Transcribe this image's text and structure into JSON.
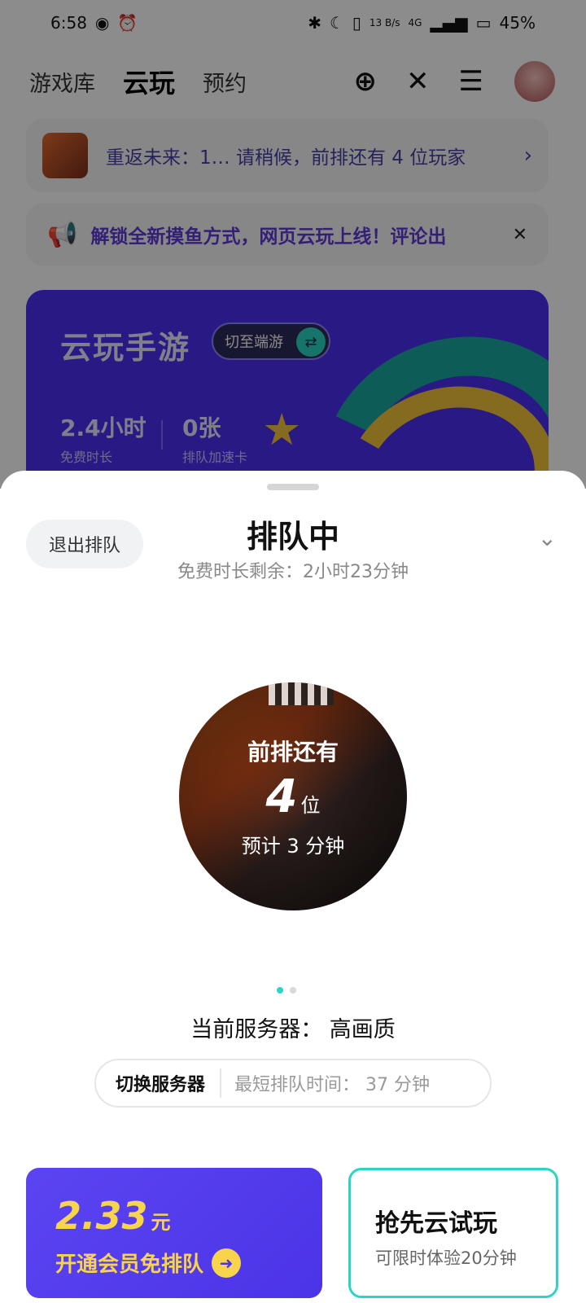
{
  "status_bar": {
    "time": "6:58",
    "net_speed": "13 B/s",
    "network": "4G",
    "battery": "45%"
  },
  "top_nav": {
    "tabs": [
      {
        "label": "游戏库",
        "active": false
      },
      {
        "label": "云玩",
        "active": true
      },
      {
        "label": "预约",
        "active": false
      }
    ]
  },
  "queue_notice": {
    "text": "重返未来：1… 请稍候，前排还有 4 位玩家"
  },
  "announcement": {
    "text": "解锁全新摸鱼方式，网页云玩上线！评论出"
  },
  "banner": {
    "title": "云玩手游",
    "switch_label": "切至端游",
    "stat1_value": "2.4小时",
    "stat1_label": "免费时长",
    "stat2_value": "0张",
    "stat2_label": "排队加速卡"
  },
  "sheet": {
    "exit_label": "退出排队",
    "title": "排队中",
    "subtitle": "免费时长剩余：2小时23分钟",
    "queue_front_label": "前排还有",
    "queue_count": "4",
    "queue_unit": "位",
    "queue_eta": "预计 3 分钟",
    "server_line": "当前服务器：  高画质",
    "switch_server": "切换服务器",
    "shortest_queue": "最短排队时间：  37 分钟",
    "vip_price": "2.33",
    "vip_currency": "元",
    "vip_label": "开通会员免排队",
    "trial_title": "抢先云试玩",
    "trial_sub": "可限时体验20分钟"
  },
  "colors": {
    "accent": "#2bd4c4",
    "brand_purple": "#4b34e6",
    "vip_gold": "#f7d44c"
  }
}
